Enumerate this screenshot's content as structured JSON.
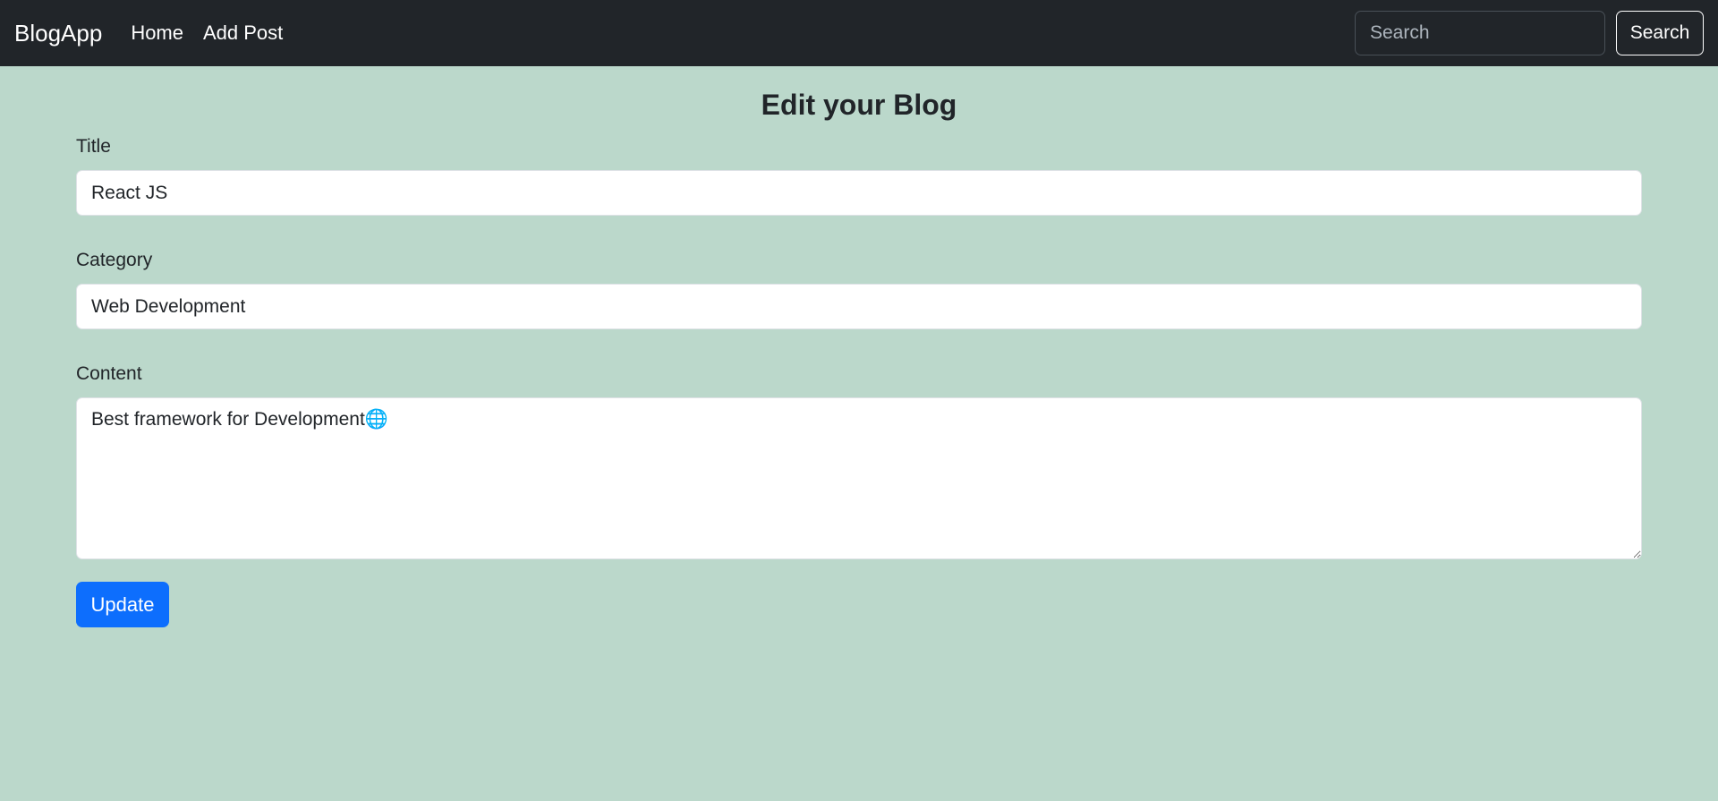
{
  "navbar": {
    "brand": "BlogApp",
    "links": [
      {
        "label": "Home"
      },
      {
        "label": "Add Post"
      }
    ],
    "search": {
      "placeholder": "Search",
      "button_label": "Search"
    }
  },
  "main": {
    "title": "Edit your Blog",
    "fields": {
      "title": {
        "label": "Title",
        "value": "React JS"
      },
      "category": {
        "label": "Category",
        "value": "Web Development"
      },
      "content": {
        "label": "Content",
        "value": "Best framework for Development🌐"
      }
    },
    "update_label": "Update"
  },
  "colors": {
    "page_background": "#bbd8cb",
    "navbar_background": "#212529",
    "primary_button": "#0d6efd"
  }
}
